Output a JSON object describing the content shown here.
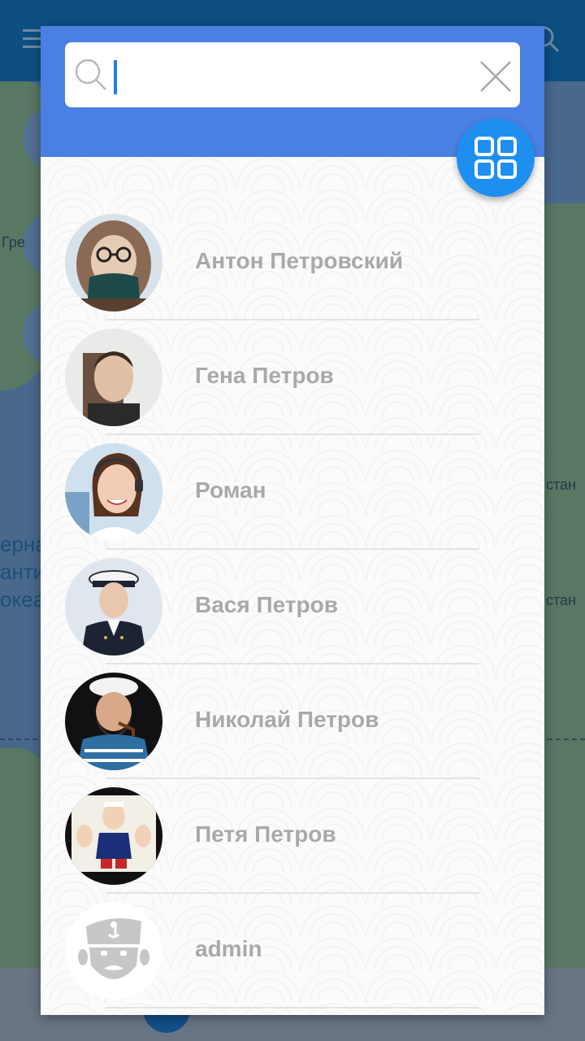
{
  "background": {
    "map_labels": [
      "Гре",
      "ерна",
      "антич",
      "океа",
      "стан",
      "стан"
    ]
  },
  "search": {
    "value": "",
    "placeholder": ""
  },
  "contacts": [
    {
      "name": "Антон Петровский"
    },
    {
      "name": "Гена Петров"
    },
    {
      "name": "Роман"
    },
    {
      "name": "Вася Петров"
    },
    {
      "name": "Николай Петров"
    },
    {
      "name": "Петя Петров"
    },
    {
      "name": "admin"
    }
  ],
  "icons": {
    "search": "search-icon",
    "clear": "close-icon",
    "grid": "grid-view-icon",
    "default_avatar": "sailor-avatar-icon"
  },
  "colors": {
    "header": "#4a7fe3",
    "grid_button": "#1e8ff0",
    "name_text": "#a9a9a9",
    "caret": "#2a7be4"
  }
}
